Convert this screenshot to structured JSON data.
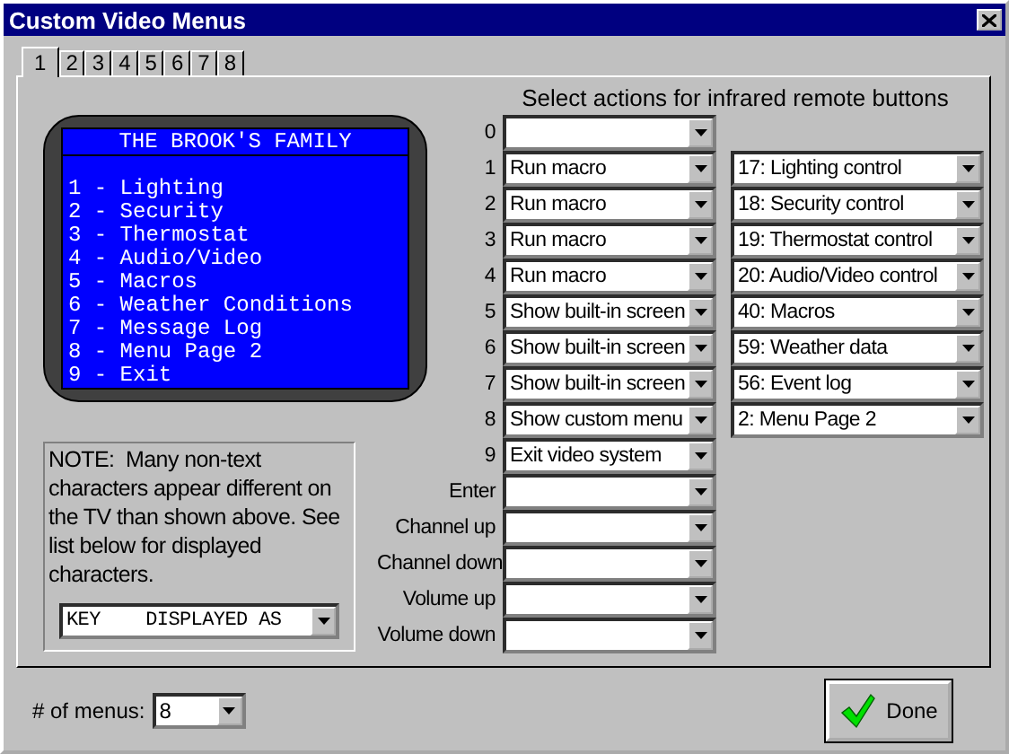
{
  "window": {
    "title": "Custom Video Menus"
  },
  "tabs": [
    {
      "label": "1",
      "selected": true
    },
    {
      "label": "2",
      "selected": false
    },
    {
      "label": "3",
      "selected": false
    },
    {
      "label": "4",
      "selected": false
    },
    {
      "label": "5",
      "selected": false
    },
    {
      "label": "6",
      "selected": false
    },
    {
      "label": "7",
      "selected": false
    },
    {
      "label": "8",
      "selected": false
    }
  ],
  "tv_preview": {
    "title": "THE BROOK'S FAMILY",
    "lines": [
      "1 - Lighting",
      "2 - Security",
      "3 - Thermostat",
      "4 - Audio/Video",
      "5 - Macros",
      "6 - Weather Conditions",
      "7 - Message Log",
      "8 - Menu Page 2",
      "9 - Exit"
    ]
  },
  "note": {
    "text": "NOTE:  Many non-text characters appear different on the TV than shown above. See list below for displayed characters.",
    "dropdown": {
      "value": "KEY    DISPLAYED AS"
    }
  },
  "actions_heading": "Select actions for infrared remote buttons",
  "buttons": [
    {
      "label": "0"
    },
    {
      "label": "1",
      "action": "Run macro",
      "target": "17: Lighting control"
    },
    {
      "label": "2",
      "action": "Run macro",
      "target": "18: Security control"
    },
    {
      "label": "3",
      "action": "Run macro",
      "target": "19: Thermostat control"
    },
    {
      "label": "4",
      "action": "Run macro",
      "target": "20: Audio/Video control"
    },
    {
      "label": "5",
      "action": "Show built-in screen",
      "target": "40: Macros"
    },
    {
      "label": "6",
      "action": "Show built-in screen",
      "target": "59: Weather data"
    },
    {
      "label": "7",
      "action": "Show built-in screen",
      "target": "56: Event log"
    },
    {
      "label": "8",
      "action": "Show custom menu",
      "target": "2: Menu Page 2"
    },
    {
      "label": "9",
      "action": "Exit video system"
    },
    {
      "label": "Enter"
    },
    {
      "label": "Channel up"
    },
    {
      "label": "Channel down"
    },
    {
      "label": "Volume up"
    },
    {
      "label": "Volume down"
    }
  ],
  "menu_count": {
    "label": "# of menus:",
    "value": "8"
  },
  "done_button": {
    "label": "Done"
  }
}
